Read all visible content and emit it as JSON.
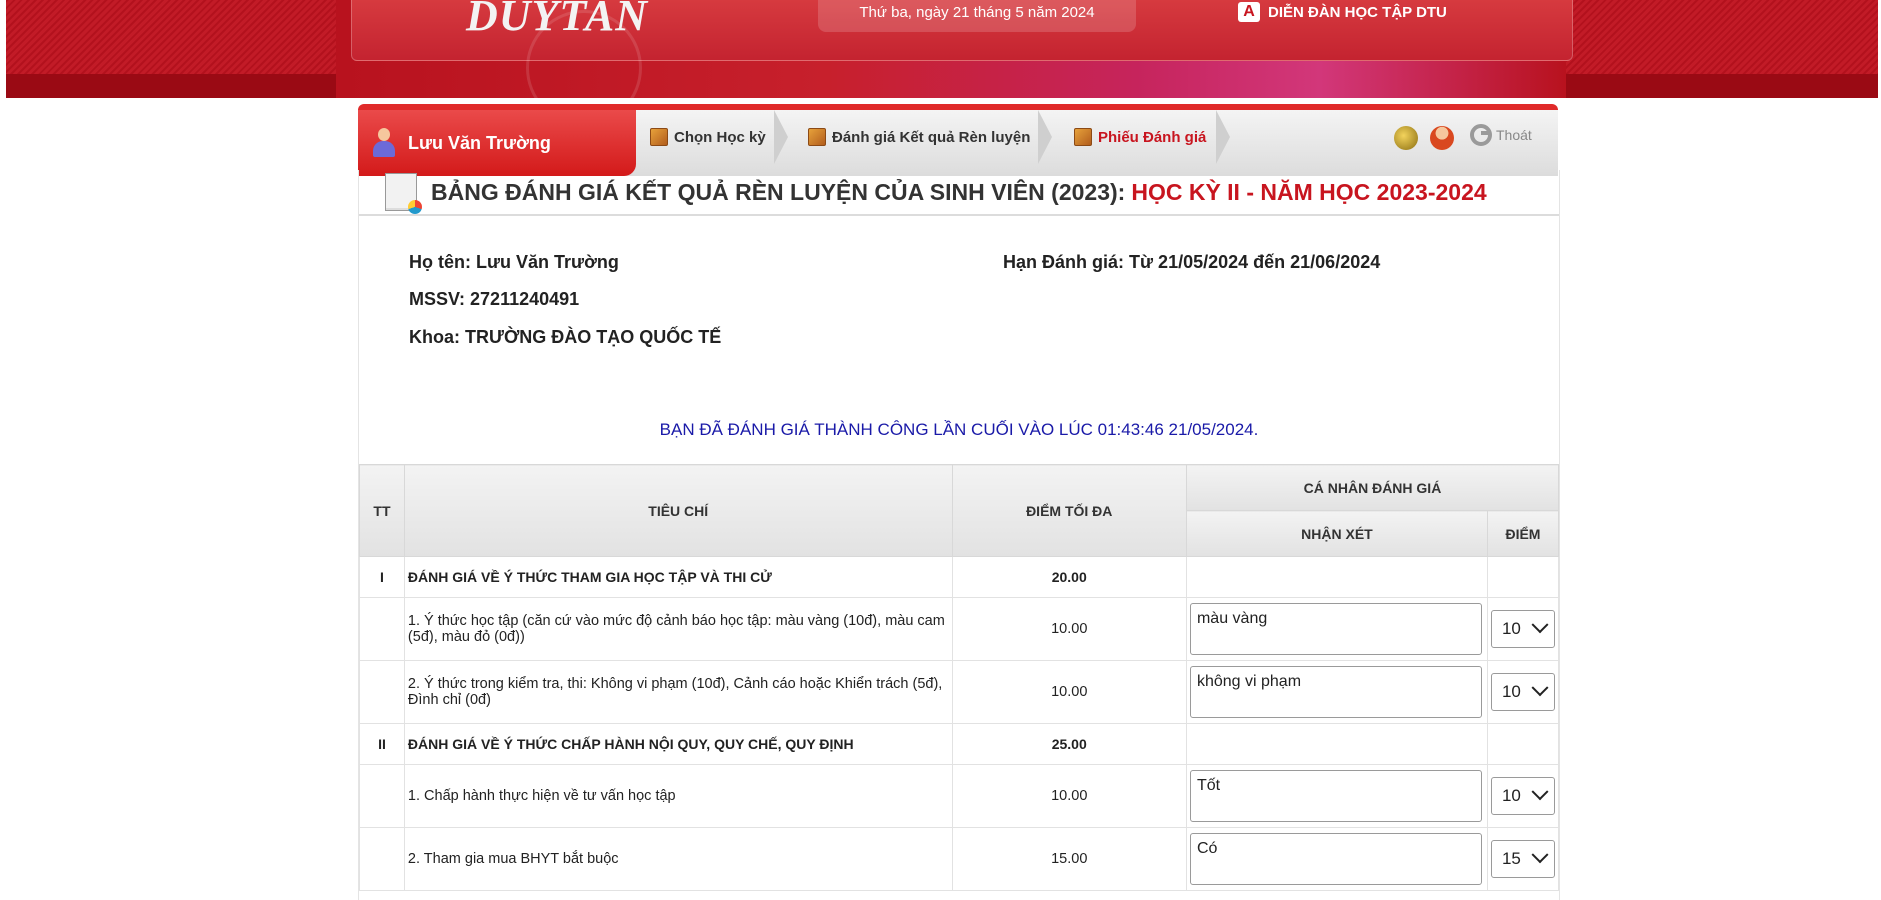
{
  "header": {
    "logo_text": "DUYTAN",
    "date": "Thứ ba, ngày 21 tháng 5 năm 2024",
    "forum_label": "DIỄN ĐÀN HỌC TẬP DTU",
    "forum_icon": "A"
  },
  "nav": {
    "user_name": "Lưu Văn Trường",
    "items": [
      {
        "label": "Chọn Học kỳ"
      },
      {
        "label": "Đánh giá Kết quả Rèn luyện"
      },
      {
        "label": "Phiếu Đánh giá"
      }
    ],
    "logout_label": "Thoát"
  },
  "page": {
    "title_main": "BẢNG ĐÁNH GIÁ KẾT QUẢ RÈN LUYỆN CỦA SINH VIÊN (2023):",
    "title_term": "HỌC KỲ II - NĂM HỌC 2023-2024",
    "name_label": "Họ tên:",
    "name_value": "Lưu Văn Trường",
    "id_label": "MSSV:",
    "id_value": "27211240491",
    "faculty_label": "Khoa:",
    "faculty_value": "TRƯỜNG ĐÀO TẠO QUỐC TẾ",
    "deadline_label": "Hạn Đánh giá:",
    "deadline_value": "Từ 21/05/2024 đến 21/06/2024",
    "success_message": "BẠN ĐÃ ĐÁNH GIÁ THÀNH CÔNG LẦN CUỐI VÀO LÚC 01:43:46 21/05/2024."
  },
  "table": {
    "headers": {
      "tt": "TT",
      "criteria": "TIÊU CHÍ",
      "max": "ĐIỂM TỐI ĐA",
      "self_eval": "CÁ NHÂN ĐÁNH GIÁ",
      "comment": "NHẬN XÉT",
      "points": "ĐIỂM"
    },
    "rows": [
      {
        "tt": "I",
        "criteria": "ĐÁNH GIÁ VỀ Ý THỨC THAM GIA HỌC TẬP VÀ THI CỬ",
        "max": "20.00"
      },
      {
        "criteria": "1. Ý thức học tập (căn cứ vào mức độ cảnh báo học tập: màu vàng (10đ), màu cam (5đ), màu đỏ (0đ))",
        "max": "10.00",
        "comment": "màu vàng",
        "points": "10"
      },
      {
        "criteria": "2. Ý thức trong kiểm tra, thi: Không vi phạm (10đ), Cảnh cáo hoặc Khiển trách (5đ), Đình chỉ (0đ)",
        "max": "10.00",
        "comment": "không vi phạm",
        "points": "10"
      },
      {
        "tt": "II",
        "criteria": "ĐÁNH GIÁ VỀ Ý THỨC CHẤP HÀNH NỘI QUY, QUY CHẾ, QUY ĐỊNH",
        "max": "25.00"
      },
      {
        "criteria": "1. Chấp hành thực hiện về tư vấn học tập",
        "max": "10.00",
        "comment": "Tốt",
        "points": "10"
      },
      {
        "criteria": "2. Tham gia mua BHYT bắt buộc",
        "max": "15.00",
        "comment": "Có",
        "points": "15"
      }
    ]
  },
  "colors": {
    "brand_red": "#c8151f",
    "message_blue": "#1a1aa8"
  }
}
